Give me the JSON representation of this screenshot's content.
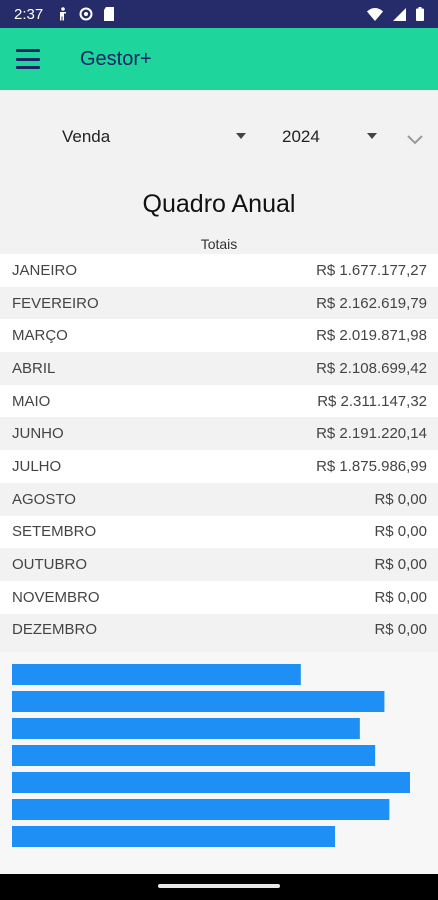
{
  "status_bar": {
    "time": "2:37",
    "left_icons": [
      "accessibility-icon",
      "sync-icon",
      "sd-card-icon"
    ],
    "right_icons": [
      "wifi-icon",
      "signal-icon",
      "battery-icon"
    ]
  },
  "app_bar": {
    "title": "Gestor+",
    "color": "#1ed69b",
    "text_color": "#1b2666"
  },
  "filters": {
    "type_value": "Venda",
    "year_value": "2024"
  },
  "summary": {
    "title": "Quadro Anual",
    "subtitle": "Totais"
  },
  "months": [
    {
      "name": "JANEIRO",
      "total": "R$ 1.677.177,27"
    },
    {
      "name": "FEVEREIRO",
      "total": "R$ 2.162.619,79"
    },
    {
      "name": "MARÇO",
      "total": "R$ 2.019.871,98"
    },
    {
      "name": "ABRIL",
      "total": "R$ 2.108.699,42"
    },
    {
      "name": "MAIO",
      "total": "R$ 2.311.147,32"
    },
    {
      "name": "JUNHO",
      "total": "R$ 2.191.220,14"
    },
    {
      "name": "JULHO",
      "total": "R$ 1.875.986,99"
    },
    {
      "name": "AGOSTO",
      "total": "R$ 0,00"
    },
    {
      "name": "SETEMBRO",
      "total": "R$ 0,00"
    },
    {
      "name": "OUTUBRO",
      "total": "R$ 0,00"
    },
    {
      "name": "NOVEMBRO",
      "total": "R$ 0,00"
    },
    {
      "name": "DEZEMBRO",
      "total": "R$ 0,00"
    }
  ],
  "chart_data": {
    "type": "bar",
    "orientation": "horizontal",
    "categories": [
      "JANEIRO",
      "FEVEREIRO",
      "MARÇO",
      "ABRIL",
      "MAIO",
      "JUNHO",
      "JULHO"
    ],
    "values": [
      1677177.27,
      2162619.79,
      2019871.98,
      2108699.42,
      2311147.32,
      2191220.14,
      1875986.99
    ],
    "xlim": [
      0,
      2311147.32
    ],
    "bar_color": "#1e8ff5",
    "grid": false,
    "axis_labels_visible": false
  }
}
